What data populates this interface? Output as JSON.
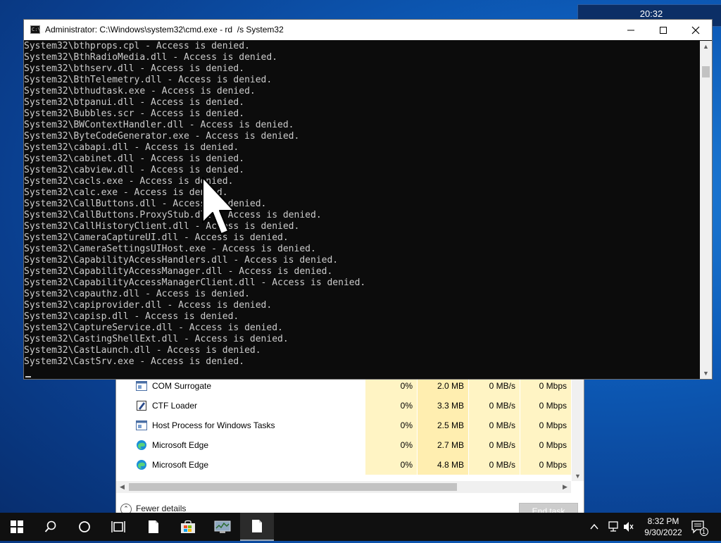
{
  "desktop": {
    "clock_widget": "20:32"
  },
  "cmd_window": {
    "title": "Administrator: C:\\Windows\\system32\\cmd.exe - rd  /s System32",
    "icon_text": "C:\\_",
    "lines": [
      "System32\\bthprops.cpl - Access is denied.",
      "System32\\BthRadioMedia.dll - Access is denied.",
      "System32\\bthserv.dll - Access is denied.",
      "System32\\BthTelemetry.dll - Access is denied.",
      "System32\\bthudtask.exe - Access is denied.",
      "System32\\btpanui.dll - Access is denied.",
      "System32\\Bubbles.scr - Access is denied.",
      "System32\\BWContextHandler.dll - Access is denied.",
      "System32\\ByteCodeGenerator.exe - Access is denied.",
      "System32\\cabapi.dll - Access is denied.",
      "System32\\cabinet.dll - Access is denied.",
      "System32\\cabview.dll - Access is denied.",
      "System32\\cacls.exe - Access is denied.",
      "System32\\calc.exe - Access is denied.",
      "System32\\CallButtons.dll - Access is denied.",
      "System32\\CallButtons.ProxyStub.dll - Access is denied.",
      "System32\\CallHistoryClient.dll - Access is denied.",
      "System32\\CameraCaptureUI.dll - Access is denied.",
      "System32\\CameraSettingsUIHost.exe - Access is denied.",
      "System32\\CapabilityAccessHandlers.dll - Access is denied.",
      "System32\\CapabilityAccessManager.dll - Access is denied.",
      "System32\\CapabilityAccessManagerClient.dll - Access is denied.",
      "System32\\capauthz.dll - Access is denied.",
      "System32\\capiprovider.dll - Access is denied.",
      "System32\\capisp.dll - Access is denied.",
      "System32\\CaptureService.dll - Access is denied.",
      "System32\\CastingShellExt.dll - Access is denied.",
      "System32\\CastLaunch.dll - Access is denied.",
      "System32\\CastSrv.exe - Access is denied."
    ]
  },
  "task_manager": {
    "rows": [
      {
        "name": "COM Surrogate",
        "icon": "window-icon",
        "cpu": "0%",
        "memory": "2.0 MB",
        "disk": "0 MB/s",
        "network": "0 Mbps"
      },
      {
        "name": "CTF Loader",
        "icon": "pen-icon",
        "cpu": "0%",
        "memory": "3.3 MB",
        "disk": "0 MB/s",
        "network": "0 Mbps"
      },
      {
        "name": "Host Process for Windows Tasks",
        "icon": "window-icon",
        "cpu": "0%",
        "memory": "2.5 MB",
        "disk": "0 MB/s",
        "network": "0 Mbps"
      },
      {
        "name": "Microsoft Edge",
        "icon": "edge-icon",
        "cpu": "0%",
        "memory": "2.7 MB",
        "disk": "0 MB/s",
        "network": "0 Mbps"
      },
      {
        "name": "Microsoft Edge",
        "icon": "edge-icon",
        "cpu": "0%",
        "memory": "4.8 MB",
        "disk": "0 MB/s",
        "network": "0 Mbps"
      }
    ],
    "fewer_details": "Fewer details",
    "end_task": "End task"
  },
  "taskbar": {
    "time": "8:32 PM",
    "date": "9/30/2022",
    "notification_count": "1"
  },
  "colors": {
    "cmd_background": "#0c0c0c",
    "cmd_text": "#cccccc",
    "taskbar": "#101010",
    "tm_highlight": "#fff4c4"
  }
}
